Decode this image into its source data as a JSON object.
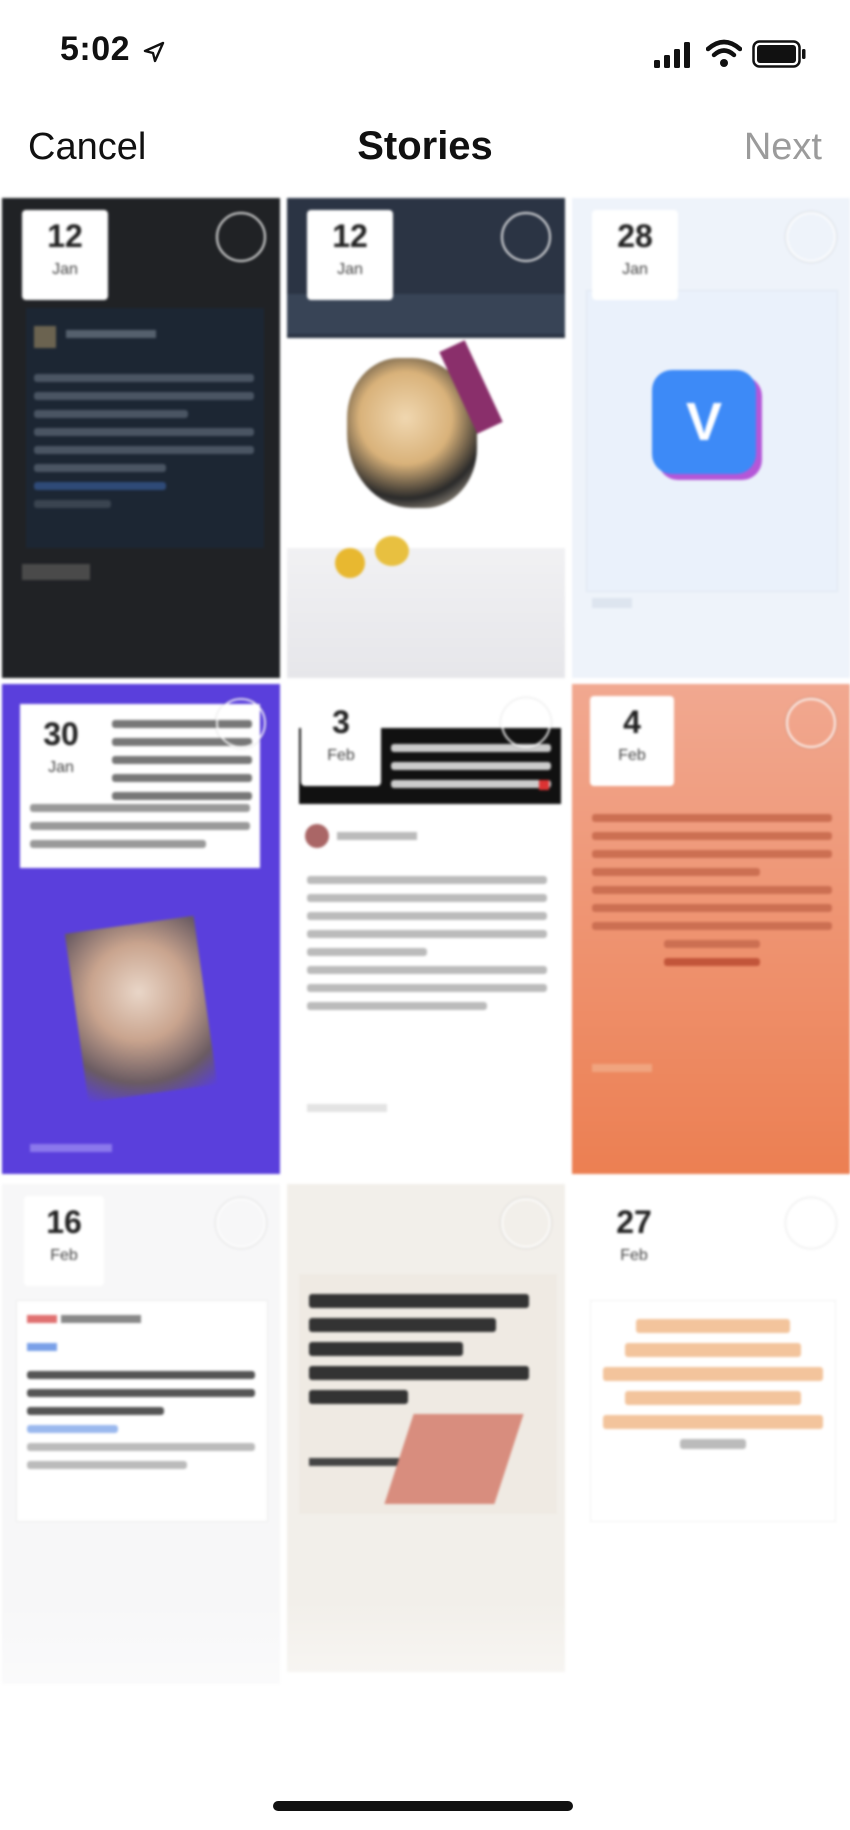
{
  "status_bar": {
    "time": "5:02",
    "icons": [
      "location-arrow-icon",
      "cellular-signal-icon",
      "wifi-icon",
      "battery-icon"
    ]
  },
  "nav": {
    "cancel_label": "Cancel",
    "title": "Stories",
    "next_label": "Next"
  },
  "colors": {
    "tile_dark": "#202225",
    "tile_purple": "#5a3fdc",
    "tile_orange": "#ee8a66",
    "venmo_blue": "#3d8af7",
    "next_disabled": "#9b9b9b"
  },
  "stories": [
    {
      "theme": "dark-tweet",
      "badge_day": "12",
      "badge_month": "Jan",
      "selected": false
    },
    {
      "theme": "dark-photo",
      "badge_day": "12",
      "badge_month": "Jan",
      "selected": false
    },
    {
      "theme": "venmo",
      "badge_day": "28",
      "badge_month": "Jan",
      "icon": "venmo-logo-icon",
      "logo_letter": "V",
      "selected": false
    },
    {
      "theme": "purple",
      "badge_day": "30",
      "badge_month": "Jan",
      "selected": false
    },
    {
      "theme": "white-tweet",
      "badge_day": "3",
      "badge_month": "Feb",
      "selected": false
    },
    {
      "theme": "orange",
      "badge_day": "4",
      "badge_month": "Feb",
      "selected": false
    },
    {
      "theme": "white-article",
      "badge_day": "16",
      "badge_month": "Feb",
      "selected": false
    },
    {
      "theme": "beige-quote",
      "badge_day": "",
      "badge_month": "",
      "selected": false
    },
    {
      "theme": "orange-text",
      "badge_day": "27",
      "badge_month": "Feb",
      "selected": false
    }
  ]
}
